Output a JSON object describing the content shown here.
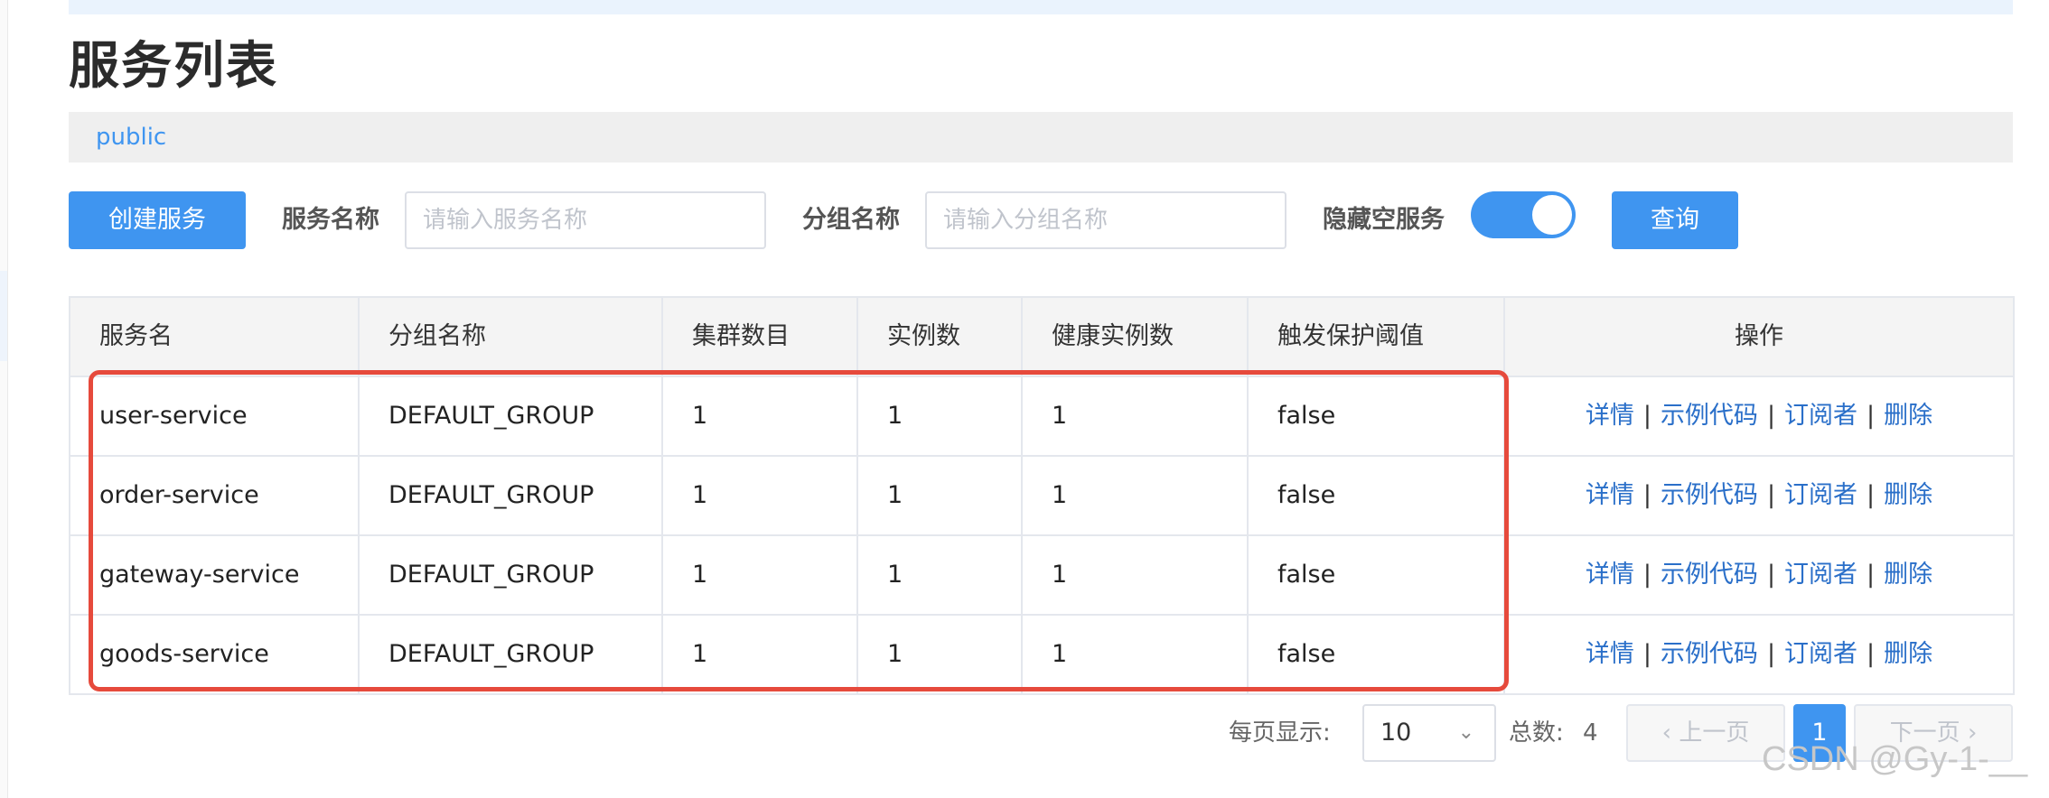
{
  "page": {
    "title": "服务列表",
    "namespace": "public"
  },
  "toolbar": {
    "create_label": "创建服务",
    "service_name_label": "服务名称",
    "service_name_placeholder": "请输入服务名称",
    "group_name_label": "分组名称",
    "group_name_placeholder": "请输入分组名称",
    "hide_empty_label": "隐藏空服务",
    "hide_empty_on": true,
    "query_label": "查询"
  },
  "table": {
    "headers": [
      "服务名",
      "分组名称",
      "集群数目",
      "实例数",
      "健康实例数",
      "触发保护阈值",
      "操作"
    ],
    "rows": [
      {
        "name": "user-service",
        "group": "DEFAULT_GROUP",
        "clusters": "1",
        "instances": "1",
        "healthy": "1",
        "protect": "false"
      },
      {
        "name": "order-service",
        "group": "DEFAULT_GROUP",
        "clusters": "1",
        "instances": "1",
        "healthy": "1",
        "protect": "false"
      },
      {
        "name": "gateway-service",
        "group": "DEFAULT_GROUP",
        "clusters": "1",
        "instances": "1",
        "healthy": "1",
        "protect": "false"
      },
      {
        "name": "goods-service",
        "group": "DEFAULT_GROUP",
        "clusters": "1",
        "instances": "1",
        "healthy": "1",
        "protect": "false"
      }
    ],
    "actions": {
      "detail": "详情",
      "sample": "示例代码",
      "subscriber": "订阅者",
      "delete": "删除",
      "separator": "|"
    }
  },
  "pager": {
    "per_page_label": "每页显示:",
    "per_page_value": "10",
    "total_label": "总数:",
    "total_value": "4",
    "prev_label": "上一页",
    "current_page": "1",
    "next_label": "下一页"
  },
  "watermark": "CSDN @Gy-1-__",
  "colors": {
    "accent": "#3f95f0",
    "link": "#2a6fc9",
    "highlight": "#e64a3c"
  }
}
